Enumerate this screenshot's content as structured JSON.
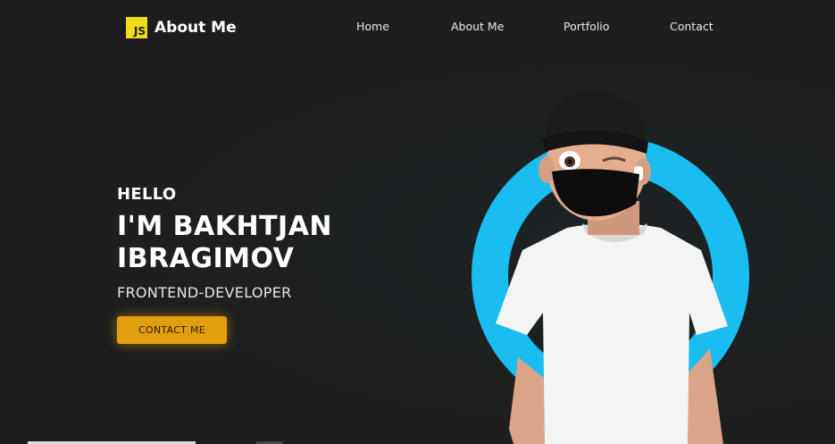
{
  "header": {
    "logo_badge": "JS",
    "logo_text": "About Me",
    "nav": [
      {
        "label": "Home"
      },
      {
        "label": "About Me"
      },
      {
        "label": "Portfolio"
      },
      {
        "label": "Contact"
      }
    ]
  },
  "hero": {
    "greeting": "HELLO",
    "name_line1": "I'M BAKHTJAN",
    "name_line2": "IBRAGIMOV",
    "role": "FRONTEND-DEVELOPER",
    "cta_label": "CONTACT ME"
  },
  "colors": {
    "background": "#1e1f1f",
    "accent": "#e19e0e",
    "ring": "#19bdf0",
    "js_badge": "#f0db1c"
  },
  "icons": {
    "logo": "js-logo-icon"
  }
}
